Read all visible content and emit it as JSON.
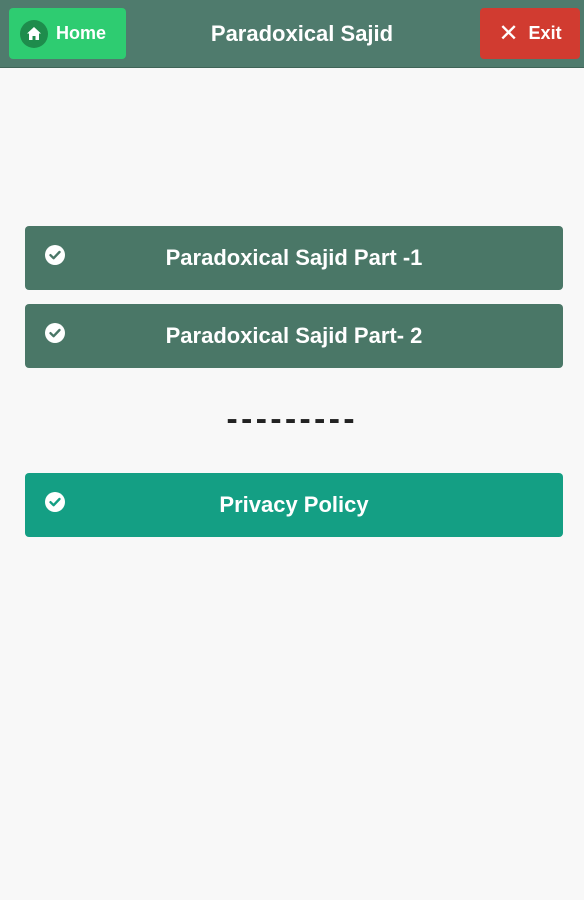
{
  "header": {
    "home_label": "Home",
    "title": "Paradoxical Sajid",
    "exit_label": "Exit"
  },
  "menu": {
    "items": [
      {
        "label": "Paradoxical Sajid Part -1",
        "icon": "check-circle-icon"
      },
      {
        "label": "Paradoxical Sajid Part- 2",
        "icon": "check-circle-icon"
      }
    ],
    "divider": "---------",
    "privacy": {
      "label": "Privacy Policy",
      "icon": "check-circle-icon"
    }
  },
  "colors": {
    "header_bg": "#4f7b6d",
    "home_button": "#2ecc71",
    "exit_button": "#d13b30",
    "menu_button": "#4a7767",
    "privacy_button": "#149f84"
  }
}
